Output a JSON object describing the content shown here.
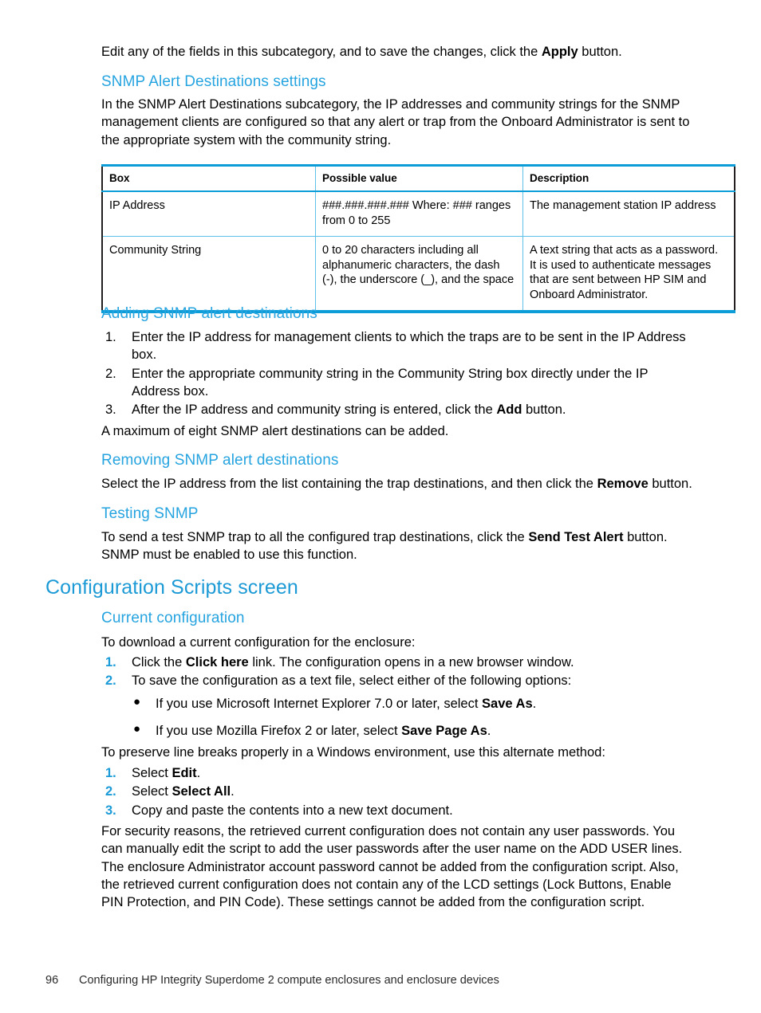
{
  "document": {
    "intro_paragraph_pre": "Edit any of the fields in this subcategory, and to save the changes, click the ",
    "intro_paragraph_bold": "Apply",
    "intro_paragraph_post": " button."
  },
  "snmp_alert_destinations": {
    "heading": "SNMP Alert Destinations settings",
    "paragraph": "In the SNMP Alert Destinations subcategory, the IP addresses and community strings for the SNMP management clients are configured so that any alert or trap from the Onboard Administrator is sent to the appropriate system with the community string.",
    "table": {
      "columns": [
        "Box",
        "Possible value",
        "Description"
      ],
      "rows": [
        [
          "IP Address",
          "###.###.###.### Where: ### ranges from 0 to 255",
          "The management station IP address"
        ],
        [
          "Community String",
          "0 to 20 characters including all alphanumeric characters, the dash (-), the underscore (_), and the space",
          "A text string that acts as a password. It is used to authenticate messages that are sent between HP SIM and Onboard Administrator."
        ]
      ]
    }
  },
  "adding_snmp": {
    "heading": "Adding SNMP alert destinations",
    "steps": [
      {
        "num": "1.",
        "text": "Enter the IP address for management clients to which the traps are to be sent in the IP Address box."
      },
      {
        "num": "2.",
        "text": "Enter the appropriate community string in the Community String box directly under the IP Address box."
      },
      {
        "num": "3.",
        "pre": "After the IP address and community string is entered, click the ",
        "bold": "Add",
        "post": " button."
      }
    ],
    "note": "A maximum of eight SNMP alert destinations can be added."
  },
  "removing_snmp": {
    "heading": "Removing SNMP alert destinations",
    "paragraph_pre": "Select the IP address from the list containing the trap destinations, and then click the ",
    "paragraph_bold": "Remove",
    "paragraph_post": " button."
  },
  "testing_snmp": {
    "heading": "Testing SNMP",
    "paragraph_pre": "To send a test SNMP trap to all the configured trap destinations, click the ",
    "paragraph_bold": "Send Test Alert",
    "paragraph_post": " button. SNMP must be enabled to use this function."
  },
  "configuration_scripts": {
    "heading": "Configuration Scripts screen",
    "current_configuration": {
      "heading": "Current configuration",
      "lead_in": "To download a current configuration for the enclosure:",
      "steps": [
        {
          "num": "1.",
          "pre": "Click the ",
          "bold": "Click here",
          "post": " link. The configuration opens in a new browser window."
        },
        {
          "num": "2.",
          "pre": "To save the configuration as a text file, select either of the following options:",
          "bold": "",
          "post": ""
        }
      ],
      "bullets": [
        {
          "pre": "If you use Microsoft Internet Explorer 7.0 or later, select ",
          "bold": "Save As",
          "post": "."
        },
        {
          "pre": "If you use Mozilla Firefox 2 or later, select ",
          "bold": "Save Page As",
          "post": "."
        }
      ],
      "alternate_lead_in": "To preserve line breaks properly in a Windows environment, use this alternate method:",
      "alternate_steps": [
        {
          "num": "1.",
          "pre": "Select ",
          "bold": "Edit",
          "post": "."
        },
        {
          "num": "2.",
          "pre": "Select ",
          "bold": "Select All",
          "post": "."
        },
        {
          "num": "3.",
          "pre": "Copy and paste the contents into a new text document.",
          "bold": "",
          "post": ""
        }
      ],
      "security_paragraph": "For security reasons, the retrieved current configuration does not contain any user passwords. You can manually edit the script to add the user passwords after the user name on the ADD USER lines. The enclosure Administrator account password cannot be added from the configuration script. Also, the retrieved current configuration does not contain any of the LCD settings (Lock Buttons, Enable PIN Protection, and PIN Code). These settings cannot be added from the configuration script."
    }
  },
  "footer": {
    "page_number": "96",
    "chapter_title": "Configuring HP Integrity Superdome 2 compute enclosures and enclosure devices"
  },
  "colors": {
    "heading_blue": "#26A4E0",
    "table_rule_blue": "#0C9CD8",
    "table_inner_blue": "#5FC0EA",
    "table_side_dark": "#231f20"
  }
}
